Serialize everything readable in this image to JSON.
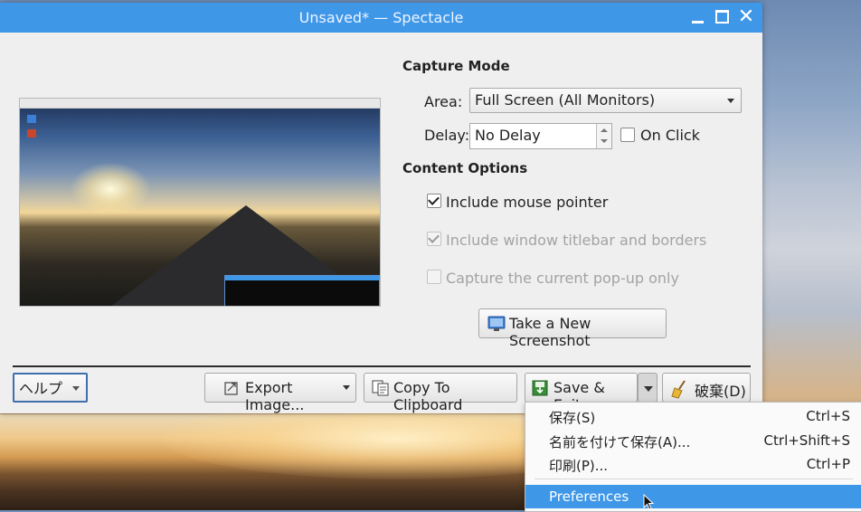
{
  "window": {
    "title": "Unsaved* — Spectacle"
  },
  "capture_mode": {
    "heading": "Capture Mode",
    "area_label": "Area:",
    "area_value": "Full Screen (All Monitors)",
    "delay_label": "Delay:",
    "delay_value": "No Delay",
    "on_click_label": "On Click",
    "on_click_checked": false
  },
  "content_options": {
    "heading": "Content Options",
    "options": [
      {
        "label": "Include mouse pointer",
        "checked": true,
        "enabled": true
      },
      {
        "label": "Include window titlebar and borders",
        "checked": true,
        "enabled": false
      },
      {
        "label": "Capture the current pop-up only",
        "checked": false,
        "enabled": false
      }
    ]
  },
  "take_screenshot_label": "Take a New Screenshot",
  "footer": {
    "help_label": "ヘルプ",
    "export_label": "Export Image...",
    "copy_label": "Copy To Clipboard",
    "save_exit_label": "Save & Exit",
    "discard_label": "破棄(D)"
  },
  "save_menu": {
    "items": [
      {
        "label": "保存(S)",
        "shortcut": "Ctrl+S"
      },
      {
        "label": "名前を付けて保存(A)...",
        "shortcut": "Ctrl+Shift+S"
      },
      {
        "label": "印刷(P)...",
        "shortcut": "Ctrl+P"
      },
      {
        "label": "Preferences",
        "shortcut": "",
        "highlighted": true
      }
    ]
  },
  "colors": {
    "accent": "#3f97e8",
    "window_bg": "#efefef"
  }
}
